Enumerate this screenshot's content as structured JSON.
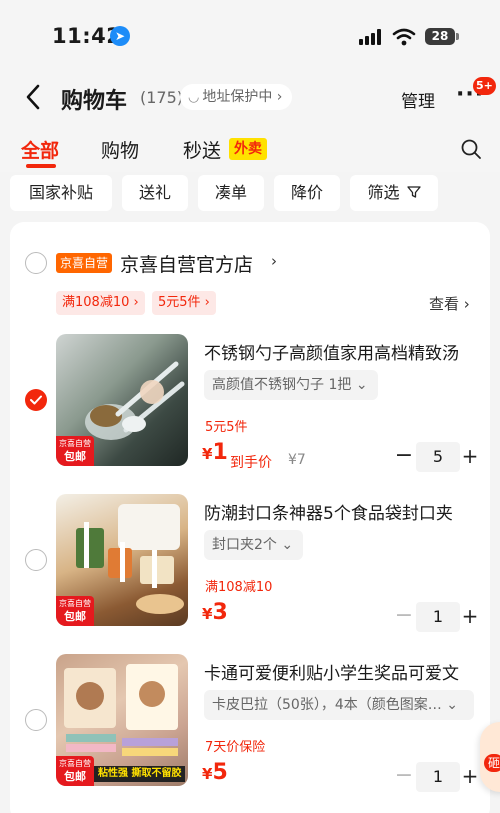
{
  "status": {
    "time": "11:42",
    "battery": "28"
  },
  "nav": {
    "title": "购物车",
    "count": "(175)",
    "address_protect": "地址保护中",
    "manage": "管理",
    "more_badge": "5+"
  },
  "tabs": [
    {
      "label": "全部"
    },
    {
      "label": "购物"
    },
    {
      "label": "秒送"
    }
  ],
  "tab_food_badge": "外卖",
  "chips": [
    {
      "label": "国家补贴"
    },
    {
      "label": "送礼"
    },
    {
      "label": "凑单"
    },
    {
      "label": "降价"
    },
    {
      "label": "筛选"
    }
  ],
  "store": {
    "logo": "京喜自营",
    "name": "京喜自营官方店",
    "coupons": [
      {
        "label": "满108减10"
      },
      {
        "label": "5元5件"
      }
    ],
    "view": "查看"
  },
  "items": [
    {
      "name": "不锈钢勺子高颜值家用高档精致汤",
      "spec": "高颜值不锈钢勺子 1把",
      "promo": "5元5件",
      "currency": "¥",
      "price": "1",
      "hand_price": "到手价",
      "orig_price": "¥7",
      "qty": "5",
      "checked": true,
      "tag_top": "京喜自营",
      "tag_bottom": "包邮"
    },
    {
      "name": "防潮封口条神器5个食品袋封口夹",
      "spec": "封口夹2个",
      "promo": "满108减10",
      "currency": "¥",
      "price": "3",
      "qty": "1",
      "checked": false,
      "tag_top": "京喜自营",
      "tag_bottom": "包邮"
    },
    {
      "name": "卡通可爱便利贴小学生奖品可爱文",
      "spec": "卡皮巴拉（50张），4本（颜色图案…",
      "promo": "7天价保险",
      "currency": "¥",
      "price": "5",
      "qty": "1",
      "checked": false,
      "tag_top": "京喜自营",
      "tag_bottom": "包邮",
      "strip": "粘性强 撕取不留胶"
    }
  ],
  "float_bubble": "砸"
}
